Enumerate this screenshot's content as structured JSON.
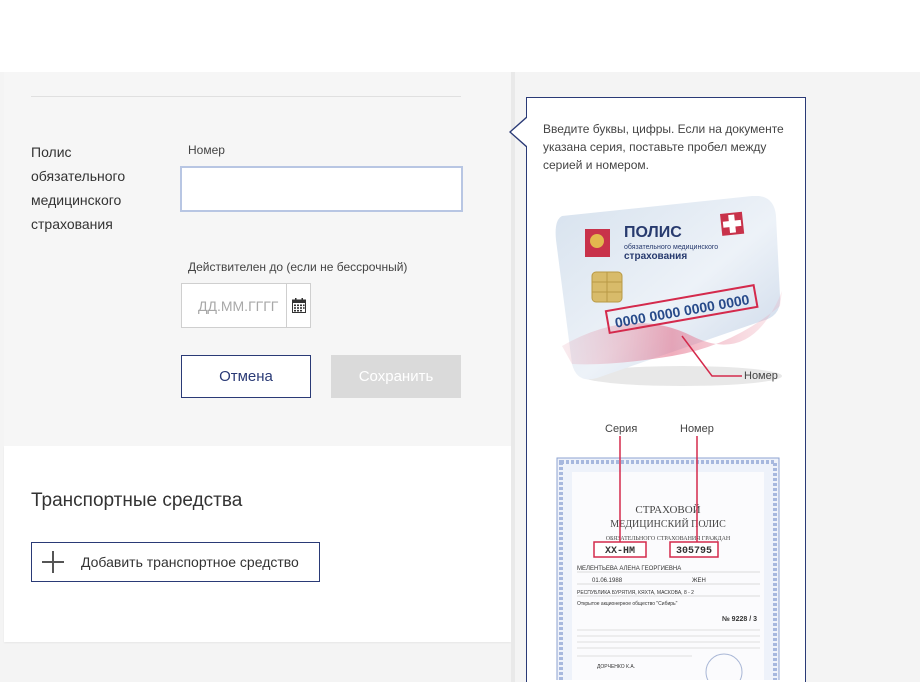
{
  "policy_form": {
    "field_label": "Полис обязательного медицинского страхования",
    "number_label": "Номер",
    "number_value": "",
    "valid_label": "Действителен до (если не бессрочный)",
    "date_placeholder": "ДД.ММ.ГГГГ",
    "date_value": "",
    "cancel_label": "Отмена",
    "save_label": "Сохранить"
  },
  "vehicles": {
    "title": "Транспортные средства",
    "add_label": "Добавить транспортное средство"
  },
  "tooltip": {
    "text": "Введите буквы, цифры. Если на документе указана серия, поставьте пробел между серией и номером.",
    "card": {
      "title": "ПОЛИС",
      "subtitle1": "обязательного медицинского",
      "subtitle2": "страхования",
      "number_digits": "0000 0000 0000 0000",
      "number_caption": "Номер"
    },
    "paper": {
      "series_caption": "Серия",
      "number_caption": "Номер",
      "header1": "СТРАХОВОЙ",
      "header2": "МЕДИЦИНСКИЙ ПОЛИС",
      "header3": "ОБЯЗАТЕЛЬНОГО СТРАХОВАНИЯ ГРАЖДАН",
      "series_value": "ХХ-НМ",
      "number_value": "305795",
      "holder_name": "МЕЛЕНТЬЕВА АЛЕНА ГЕОРГИЕВНА",
      "birth_date": "01.06.1988",
      "gender": "ЖЕН",
      "address": "РЕСПУБЛИКА БУРЯТИЯ, КЯХТА, МАСКОВА, 8 - 2",
      "insurer": "Открытое акционерное общество \"Сибирь\"",
      "doc_number": "№ 9228 / 3",
      "signer": "ДОРЧЕНКО К.А."
    }
  }
}
